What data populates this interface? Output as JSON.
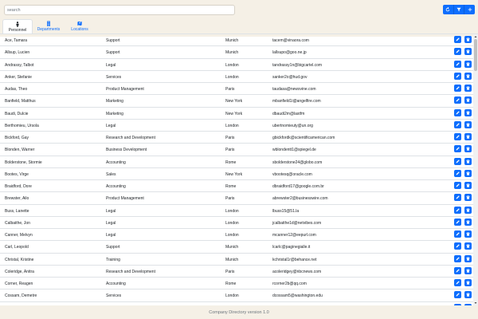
{
  "search": {
    "placeholder": "search"
  },
  "tabs": [
    {
      "label": "Personnel",
      "icon": "person-icon",
      "active": true
    },
    {
      "label": "Departments",
      "icon": "building-icon",
      "active": false
    },
    {
      "label": "Locations",
      "icon": "map-icon",
      "active": false
    }
  ],
  "toolbar": {
    "buttons": [
      "refresh-icon",
      "filter-icon",
      "plus-icon"
    ],
    "accent": "#0d6efd"
  },
  "rows": [
    [
      "Ace, Tamara",
      "Support",
      "Munich",
      "tacem@vinaora.com"
    ],
    [
      "Allsup, Lucien",
      "Support",
      "Munich",
      "lallsupo@goo.ne.jp"
    ],
    [
      "Andrassy, Talbot",
      "Legal",
      "London",
      "tandrassy1n@bigcartel.com"
    ],
    [
      "Anker, Stefanie",
      "Services",
      "London",
      "sanker2o@hud.gov"
    ],
    [
      "Audas, Theo",
      "Product Management",
      "Paris",
      "taudasa@newsvine.com"
    ],
    [
      "Banfield, Matthus",
      "Marketing",
      "New York",
      "mbanfield1i@angelfire.com"
    ],
    [
      "Baudi, Dulcie",
      "Marketing",
      "New York",
      "dbaudi2m@lastfm"
    ],
    [
      "Berthomieu, Ursola",
      "Legal",
      "London",
      "ubertnomieuty@un.org"
    ],
    [
      "Bickford, Gay",
      "Research and Development",
      "Paris",
      "gbickfordk@scientificamerican.com"
    ],
    [
      "Blonden, Warner",
      "Business Development",
      "Paris",
      "wblondentt1@spiegel.de"
    ],
    [
      "Bolderstone, Stormie",
      "Accounting",
      "Rome",
      "sbolderstone24@globo.com"
    ],
    [
      "Bootes, Virge",
      "Sales",
      "New York",
      "vbootesq@oracle.com"
    ],
    [
      "Braidford, Dore",
      "Accounting",
      "Rome",
      "dbraidford17@google.com.br"
    ],
    [
      "Brewster, Ailo",
      "Product Management",
      "Paris",
      "abrewster2@businesswire.com"
    ],
    [
      "Buss, Lanette",
      "Legal",
      "London",
      "lbuss15@51.la"
    ],
    [
      "Calbaithe, Jon",
      "Legal",
      "London",
      "jcalbaithe1d@netvibes.com"
    ],
    [
      "Canner, Melvyn",
      "Legal",
      "London",
      "mcanner12@eepurl.com"
    ],
    [
      "Carl, Leopold",
      "Support",
      "Munich",
      "lcarlc@paginegialle.it"
    ],
    [
      "Christal, Kristine",
      "Training",
      "Munich",
      "kchristal1r@behance.net"
    ],
    [
      "Coleridge, Anitra",
      "Research and Development",
      "Paris",
      "acoleridgey@nbcnews.com"
    ],
    [
      "Corner, Reagen",
      "Accounting",
      "Rome",
      "rcorner2b@qq.com"
    ],
    [
      "Cossam, Demetre",
      "Services",
      "London",
      "dcossam5@washington.edu"
    ],
    [
      "",
      "",
      "",
      ""
    ]
  ],
  "footer": {
    "text": "Company Directory version 1.0"
  }
}
